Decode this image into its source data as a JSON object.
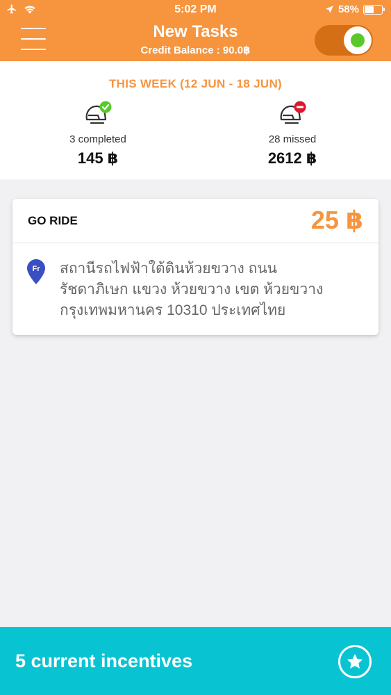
{
  "status_bar": {
    "time": "5:02 PM",
    "battery_percent": "58%",
    "battery_level": 0.58,
    "icons": [
      "airplane-icon",
      "wifi-icon",
      "location-arrow-icon",
      "battery-icon"
    ]
  },
  "header": {
    "title": "New Tasks",
    "credit_balance": "Credit Balance : 90.0฿",
    "online_toggle": true,
    "colors": {
      "header": "#f7943e",
      "toggle_track": "#d56f15",
      "toggle_dot": "#5ac82b"
    }
  },
  "summary": {
    "week_label": "THIS WEEK (12 JUN - 18 JUN)",
    "completed": {
      "label": "3 completed",
      "value": "145 ฿",
      "badge_color": "#5ac82b",
      "icon": "helmet-check-icon"
    },
    "missed": {
      "label": "28 missed",
      "value": "2612 ฿",
      "badge_color": "#e0142b",
      "icon": "helmet-minus-icon"
    }
  },
  "task_card": {
    "title": "GO RIDE",
    "price": "25 ฿",
    "pin_label": "Fr",
    "address_lines": [
      "สถานีรถไฟฟ้าใต้ดินห้วยขวาง ถนน",
      "รัชดาภิเษก แขวง ห้วยขวาง เขต ห้วยขวาง",
      "กรุงเทพมหานคร 10310 ประเทศไทย"
    ]
  },
  "bottom_bar": {
    "label": "5 current incentives",
    "color": "#08c4d3",
    "icon": "star-icon"
  }
}
